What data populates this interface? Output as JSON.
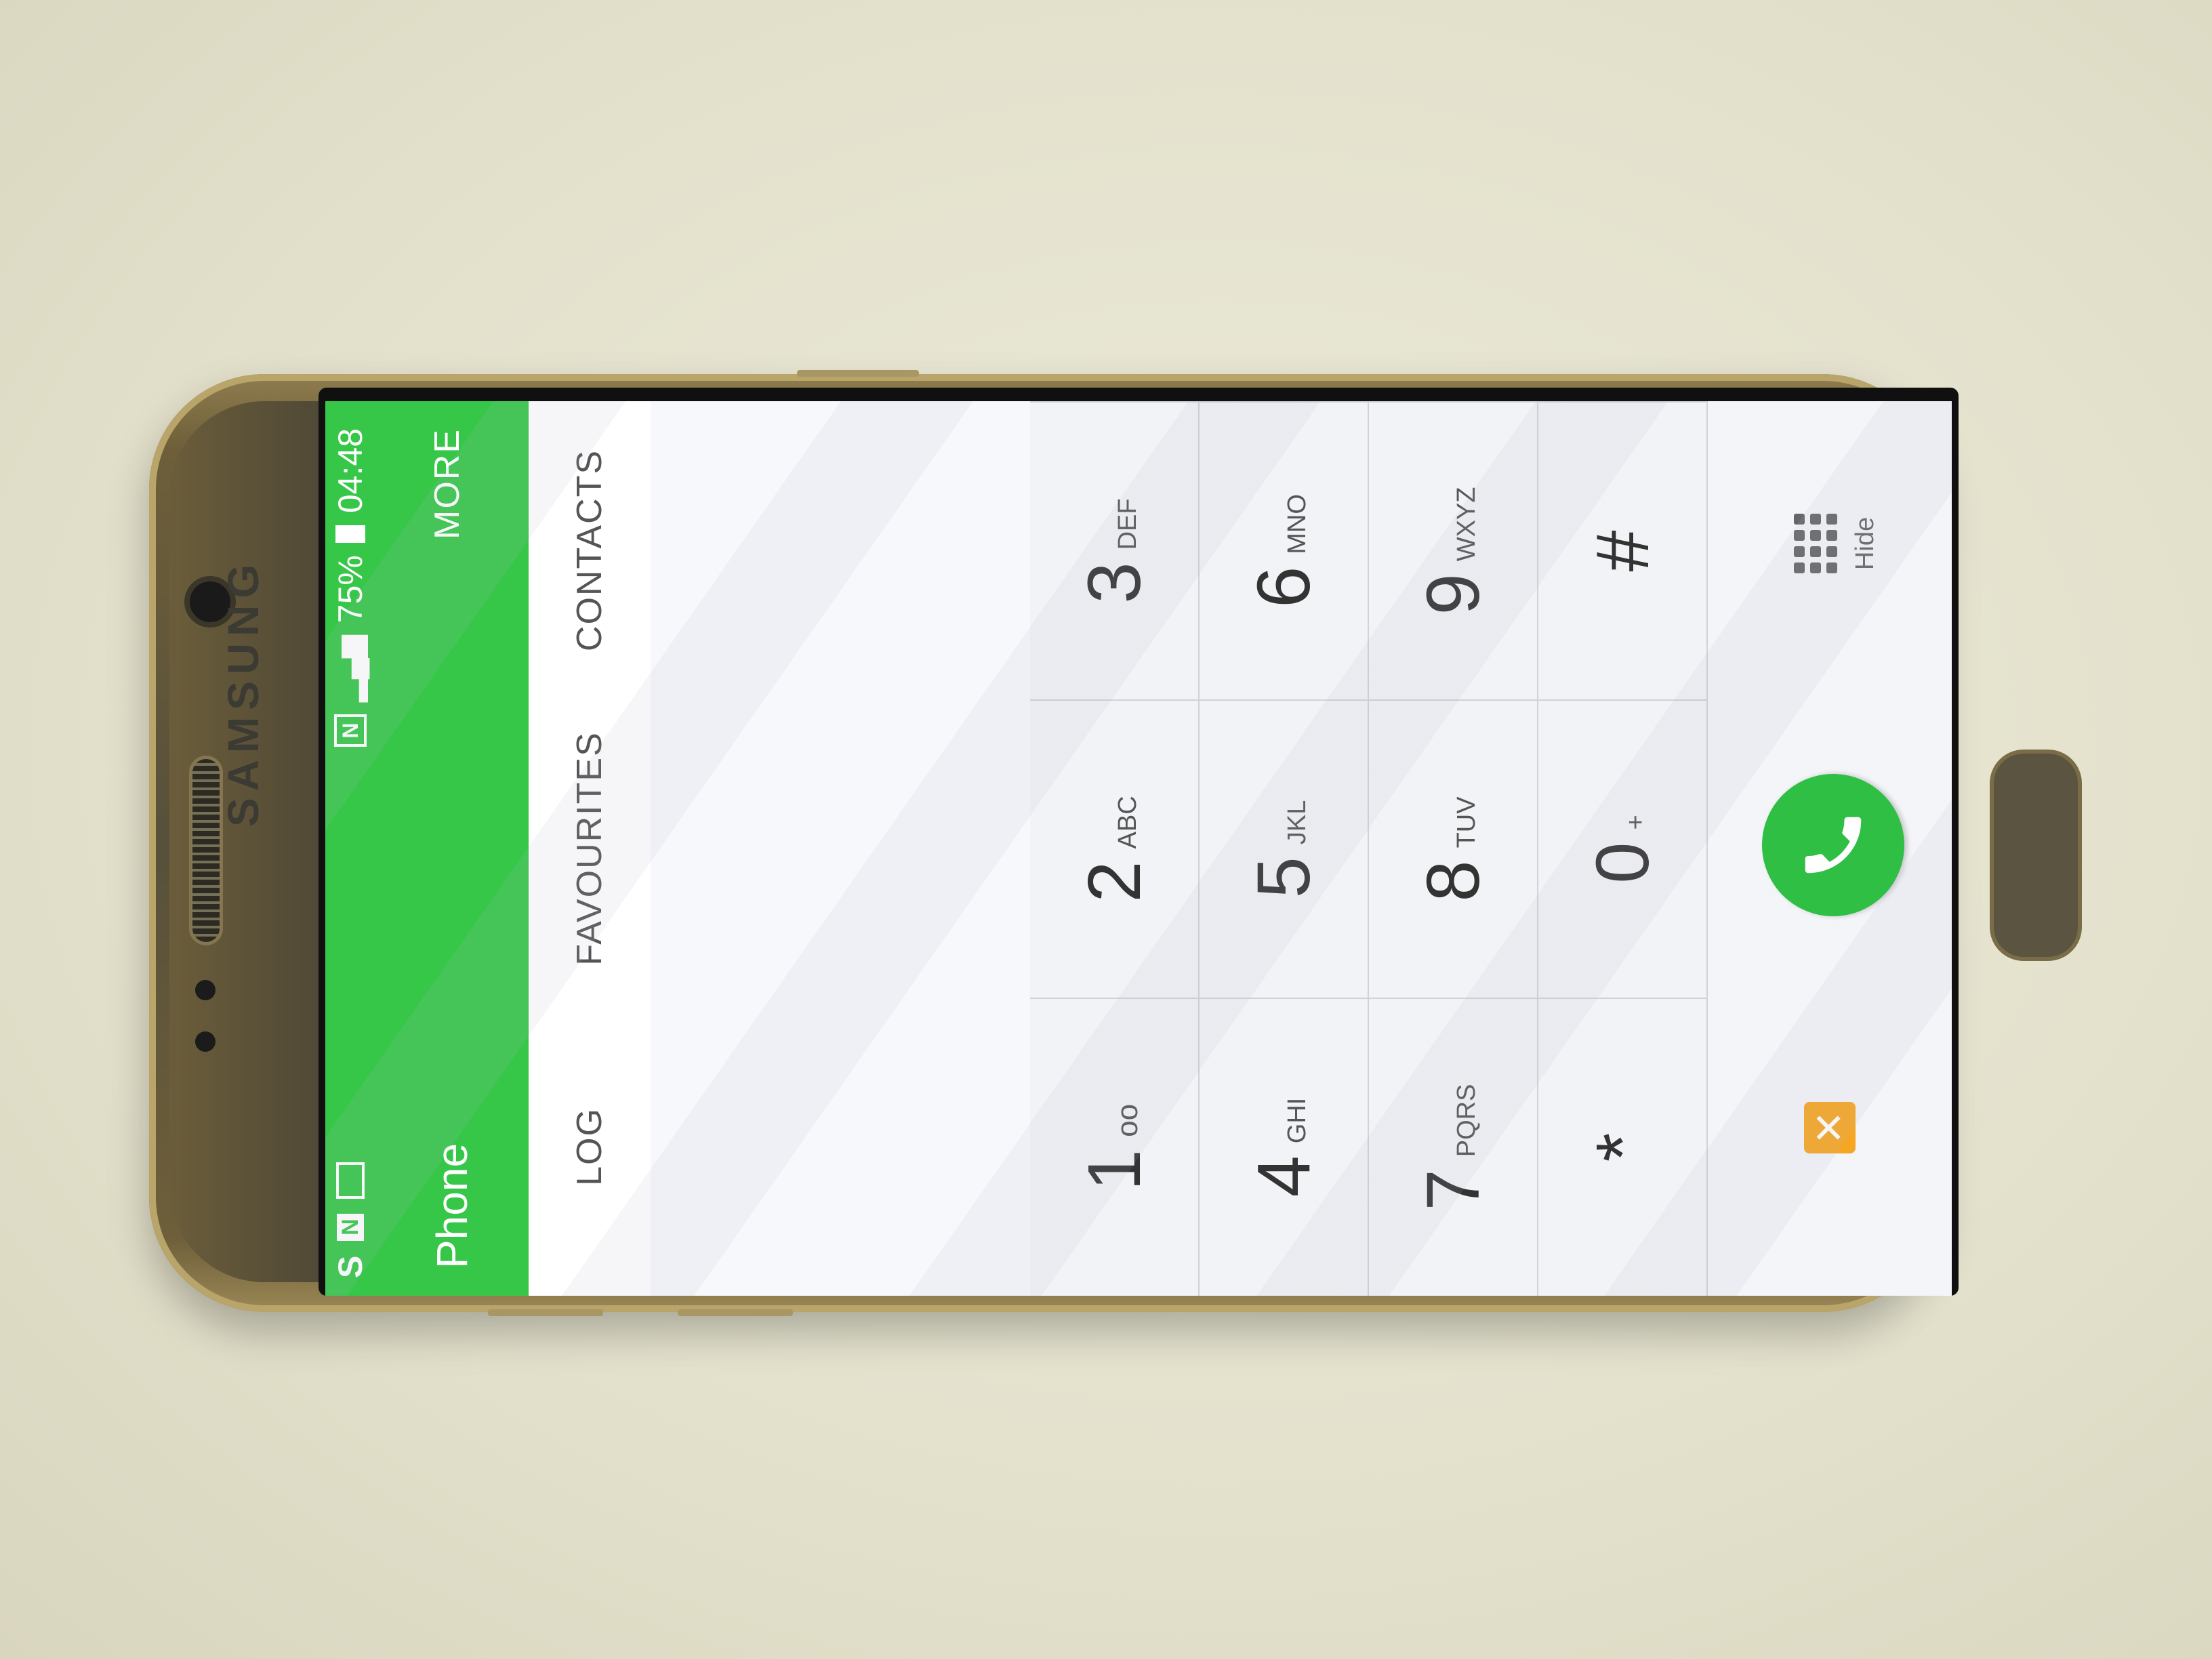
{
  "device": {
    "brand": "SAMSUNG"
  },
  "status_bar": {
    "battery": "75%",
    "time": "04:48"
  },
  "header": {
    "title": "Phone",
    "more": "MORE"
  },
  "tabs": [
    {
      "label": "LOG"
    },
    {
      "label": "FAVOURITES"
    },
    {
      "label": "CONTACTS"
    }
  ],
  "keypad": [
    {
      "digit": "1",
      "letters": ""
    },
    {
      "digit": "2",
      "letters": "ABC"
    },
    {
      "digit": "3",
      "letters": "DEF"
    },
    {
      "digit": "4",
      "letters": "GHI"
    },
    {
      "digit": "5",
      "letters": "JKL"
    },
    {
      "digit": "6",
      "letters": "MNO"
    },
    {
      "digit": "7",
      "letters": "PQRS"
    },
    {
      "digit": "8",
      "letters": "TUV"
    },
    {
      "digit": "9",
      "letters": "WXYZ"
    },
    {
      "digit": "*",
      "letters": ""
    },
    {
      "digit": "0",
      "letters": "+"
    },
    {
      "digit": "#",
      "letters": ""
    }
  ],
  "actions": {
    "hide_label": "Hide"
  },
  "colors": {
    "header_green": "#36c748",
    "call_green": "#2fbf45",
    "orange_icon": "#f5a623"
  }
}
